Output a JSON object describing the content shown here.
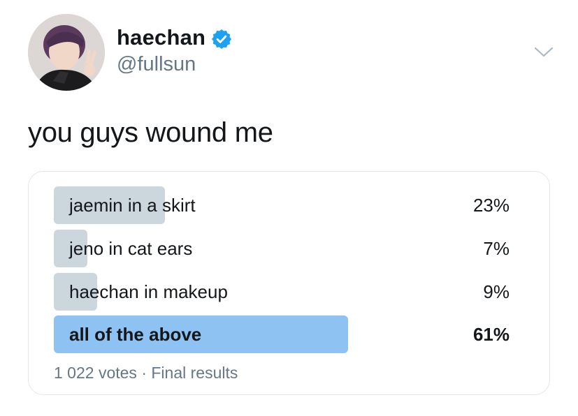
{
  "user": {
    "name": "haechan",
    "handle": "@fullsun",
    "verified": true,
    "avatar": "profile-photo"
  },
  "tweet": {
    "text": "you guys wound me"
  },
  "poll": {
    "options": [
      {
        "label": "jaemin in a skirt",
        "percent": "23%",
        "value": 23,
        "winner": false
      },
      {
        "label": "jeno in cat ears",
        "percent": "7%",
        "value": 7,
        "winner": false
      },
      {
        "label": "haechan in makeup",
        "percent": "9%",
        "value": 9,
        "winner": false
      },
      {
        "label": "all of the above",
        "percent": "61%",
        "value": 61,
        "winner": true
      }
    ],
    "votes": "1 022 votes",
    "status": "Final results",
    "separator": "·"
  },
  "colors": {
    "bar": "#ccd6dd",
    "winner_bar": "#8ec2f3",
    "verified": "#1da1f2",
    "muted": "#657786"
  },
  "icons": {
    "verified": "verified-badge-icon",
    "menu": "chevron-down-icon"
  }
}
